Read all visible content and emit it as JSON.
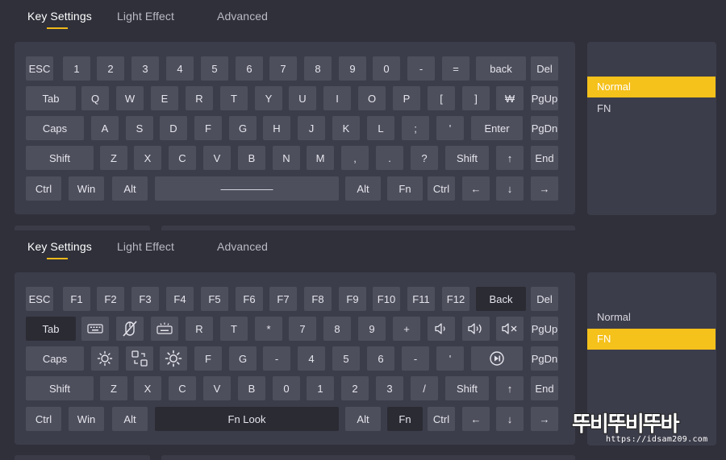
{
  "tabs": [
    "Key Settings",
    "Light Effect",
    "Advanced"
  ],
  "accent_color": "#f5c11b",
  "layer_list": [
    "Normal",
    "FN"
  ],
  "normal_layer": {
    "selected": "Normal",
    "rows": [
      [
        "ESC",
        "1",
        "2",
        "3",
        "4",
        "5",
        "6",
        "7",
        "8",
        "9",
        "0",
        "-",
        "=",
        "back",
        "Del"
      ],
      [
        "Tab",
        "Q",
        "W",
        "E",
        "R",
        "T",
        "Y",
        "U",
        "I",
        "O",
        "P",
        "[",
        "]",
        "₩",
        "PgUp"
      ],
      [
        "Caps",
        "A",
        "S",
        "D",
        "F",
        "G",
        "H",
        "J",
        "K",
        "L",
        ";",
        "'",
        "Enter",
        "PgDn"
      ],
      [
        "Shift",
        "Z",
        "X",
        "C",
        "V",
        "B",
        "N",
        "M",
        ",",
        ".",
        "?",
        "Shift",
        "↑",
        "End"
      ],
      [
        "Ctrl",
        "Win",
        "Alt",
        "―――――",
        "Alt",
        "Fn",
        "Ctrl",
        "←",
        "↓",
        "→"
      ]
    ]
  },
  "fn_layer": {
    "selected": "FN",
    "rows": [
      [
        "ESC",
        "F1",
        "F2",
        "F3",
        "F4",
        "F5",
        "F6",
        "F7",
        "F8",
        "F9",
        "F10",
        "F11",
        "F12",
        "Back",
        "Del"
      ],
      [
        "Tab",
        "keyboard-icon",
        "mouse-disabled-icon",
        "keyboard-backlight-icon",
        "R",
        "T",
        "*",
        "7",
        "8",
        "9",
        "+",
        "volume-down-icon",
        "volume-up-icon",
        "volume-mute-icon",
        "PgUp"
      ],
      [
        "Caps",
        "brightness-down-icon",
        "layout-switch-icon",
        "brightness-up-icon",
        "F",
        "G",
        "-",
        "4",
        "5",
        "6",
        "-",
        "'",
        "play-pause-icon",
        "PgDn"
      ],
      [
        "Shift",
        "Z",
        "X",
        "C",
        "V",
        "B",
        "0",
        "1",
        "2",
        "3",
        "/",
        "Shift",
        "↑",
        "End"
      ],
      [
        "Ctrl",
        "Win",
        "Alt",
        "Fn Look",
        "Alt",
        "Fn",
        "Ctrl",
        "←",
        "↓",
        "→"
      ]
    ]
  },
  "watermark": {
    "title": "뚜비뚜비뚜바",
    "url": "https://idsam209.com"
  }
}
